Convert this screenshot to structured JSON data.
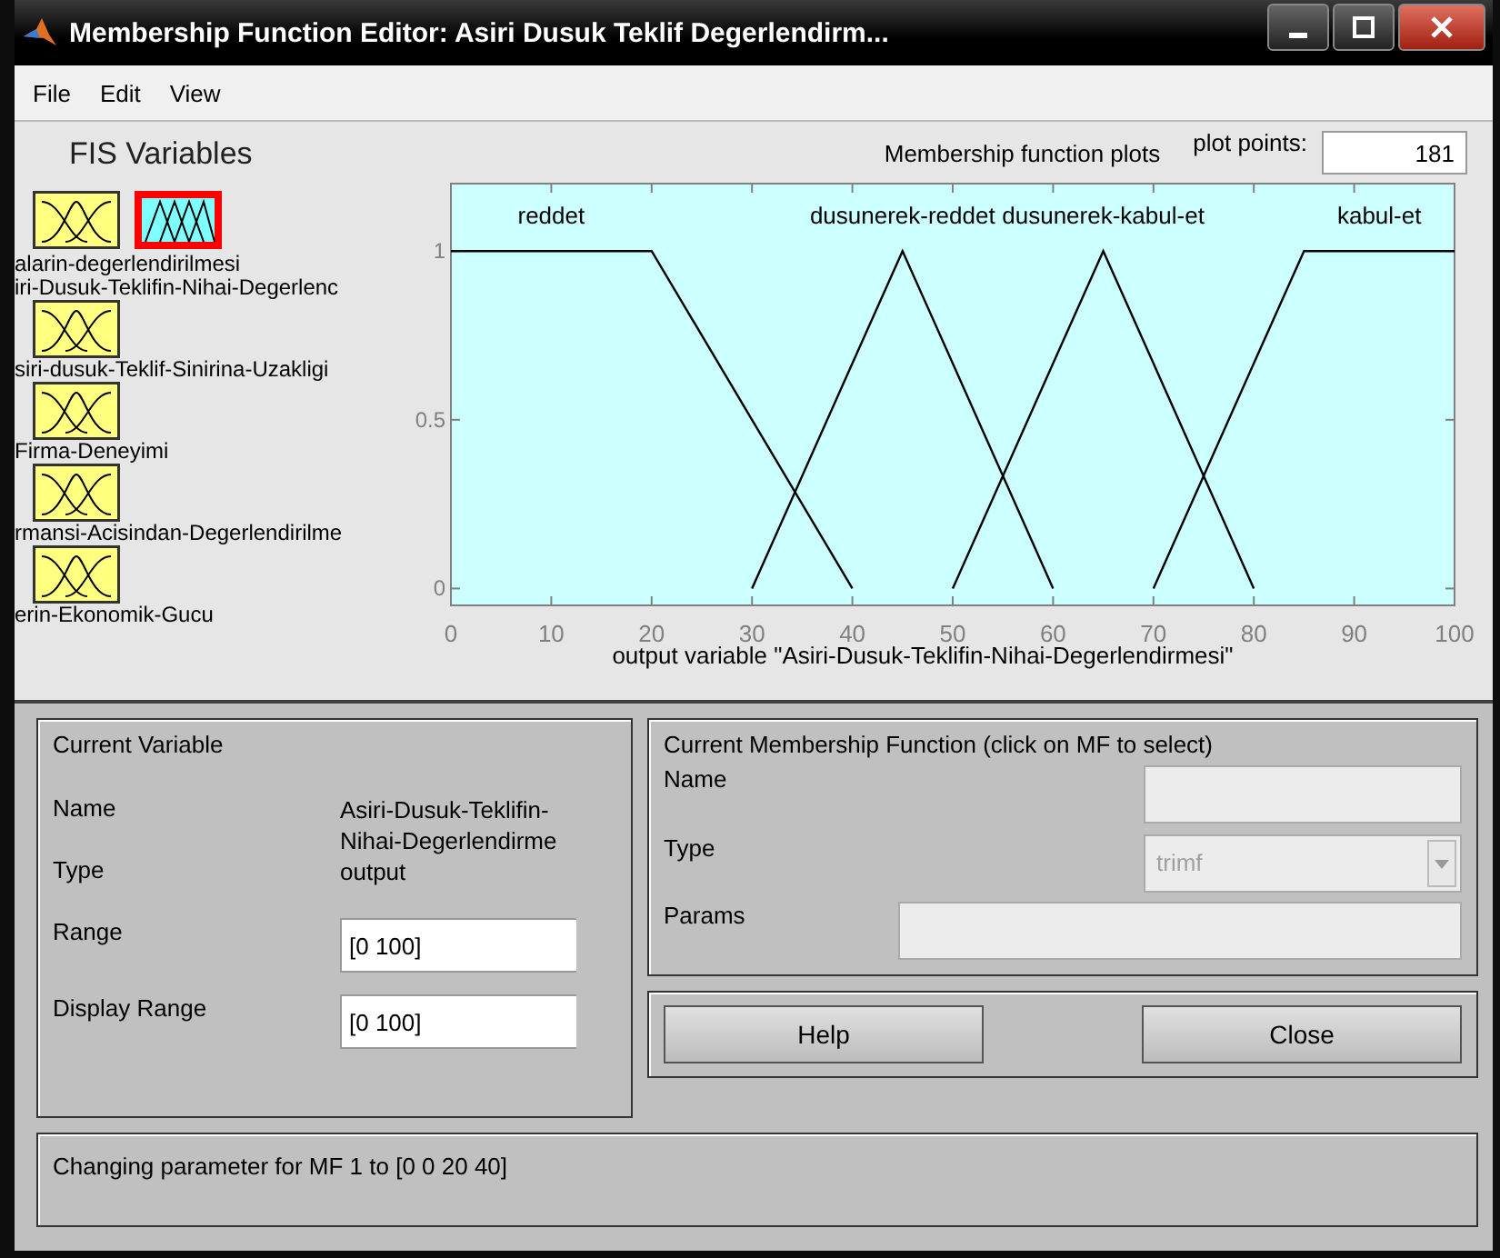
{
  "window": {
    "title": "Membership Function Editor: Asiri Dusuk Teklif Degerlendirm..."
  },
  "menu": [
    {
      "label": "File"
    },
    {
      "label": "Edit"
    },
    {
      "label": "View"
    }
  ],
  "fis_variables": {
    "title": "FIS Variables",
    "items": [
      {
        "label": "alarin-degerlendirilmesi",
        "kind": "input",
        "selected": false
      },
      {
        "label": "iri-Dusuk-Teklifin-Nihai-Degerlenc",
        "kind": "output",
        "selected": true
      },
      {
        "label": "siri-dusuk-Teklif-Sinirina-Uzakligi",
        "kind": "input",
        "selected": false
      },
      {
        "label": "Firma-Deneyimi",
        "kind": "input",
        "selected": false
      },
      {
        "label": "rmansi-Acisindan-Degerlendirilme",
        "kind": "input",
        "selected": false
      },
      {
        "label": "erin-Ekonomik-Gucu",
        "kind": "input",
        "selected": false
      }
    ]
  },
  "plot": {
    "title": "Membership function plots",
    "points_label": "plot points:",
    "points_value": "181",
    "chart_data": {
      "type": "line",
      "xlabel": "output variable \"Asiri-Dusuk-Teklifin-Nihai-Degerlendirmesi\"",
      "x": [
        0,
        20,
        30,
        40,
        45,
        50,
        60,
        65,
        70,
        80,
        85,
        100
      ],
      "series": [
        {
          "name": "reddet",
          "color": "#000000",
          "values": [
            1,
            1,
            0.5,
            0,
            null,
            null,
            null,
            null,
            null,
            null,
            null,
            null
          ]
        },
        {
          "name": "dusunerek-reddet",
          "color": "#000000",
          "values": [
            null,
            null,
            0,
            0.667,
            1,
            0.667,
            0,
            null,
            null,
            null,
            null,
            null
          ]
        },
        {
          "name": "dusunerek-kabul-et",
          "color": "#000000",
          "values": [
            null,
            null,
            null,
            null,
            null,
            0,
            0.667,
            1,
            0.667,
            0,
            null,
            null
          ]
        },
        {
          "name": "kabul-et",
          "color": "#000000",
          "values": [
            null,
            null,
            null,
            null,
            null,
            null,
            null,
            null,
            0,
            0.667,
            1,
            1
          ]
        }
      ],
      "xlim": [
        0,
        100
      ],
      "ylim": [
        -0.05,
        1.2
      ],
      "xticks": [
        0,
        10,
        20,
        30,
        40,
        50,
        60,
        70,
        80,
        90,
        100
      ],
      "yticks": [
        0,
        0.5,
        1
      ]
    }
  },
  "current_variable": {
    "title": "Current Variable",
    "fields": [
      {
        "label": "Name",
        "kind": "text",
        "value": "Asiri-Dusuk-Teklifin-Nihai-Degerlendirme"
      },
      {
        "label": "Type",
        "kind": "text",
        "value": "output"
      },
      {
        "label": "Range",
        "kind": "input",
        "value": "[0 100]"
      },
      {
        "label": "Display Range",
        "kind": "input",
        "value": "[0 100]"
      }
    ]
  },
  "current_mf": {
    "title": "Current Membership Function (click on MF to select)",
    "fields": [
      {
        "label": "Name",
        "kind": "input",
        "disabled": true
      },
      {
        "label": "Type",
        "kind": "dropdown",
        "value": "trimf",
        "disabled": true
      },
      {
        "label": "Params",
        "kind": "wide",
        "disabled": true
      }
    ]
  },
  "buttons": [
    {
      "label": "Help"
    },
    {
      "label": "Close"
    }
  ],
  "status": "Changing parameter for MF 1 to  [0 0 20 40]"
}
